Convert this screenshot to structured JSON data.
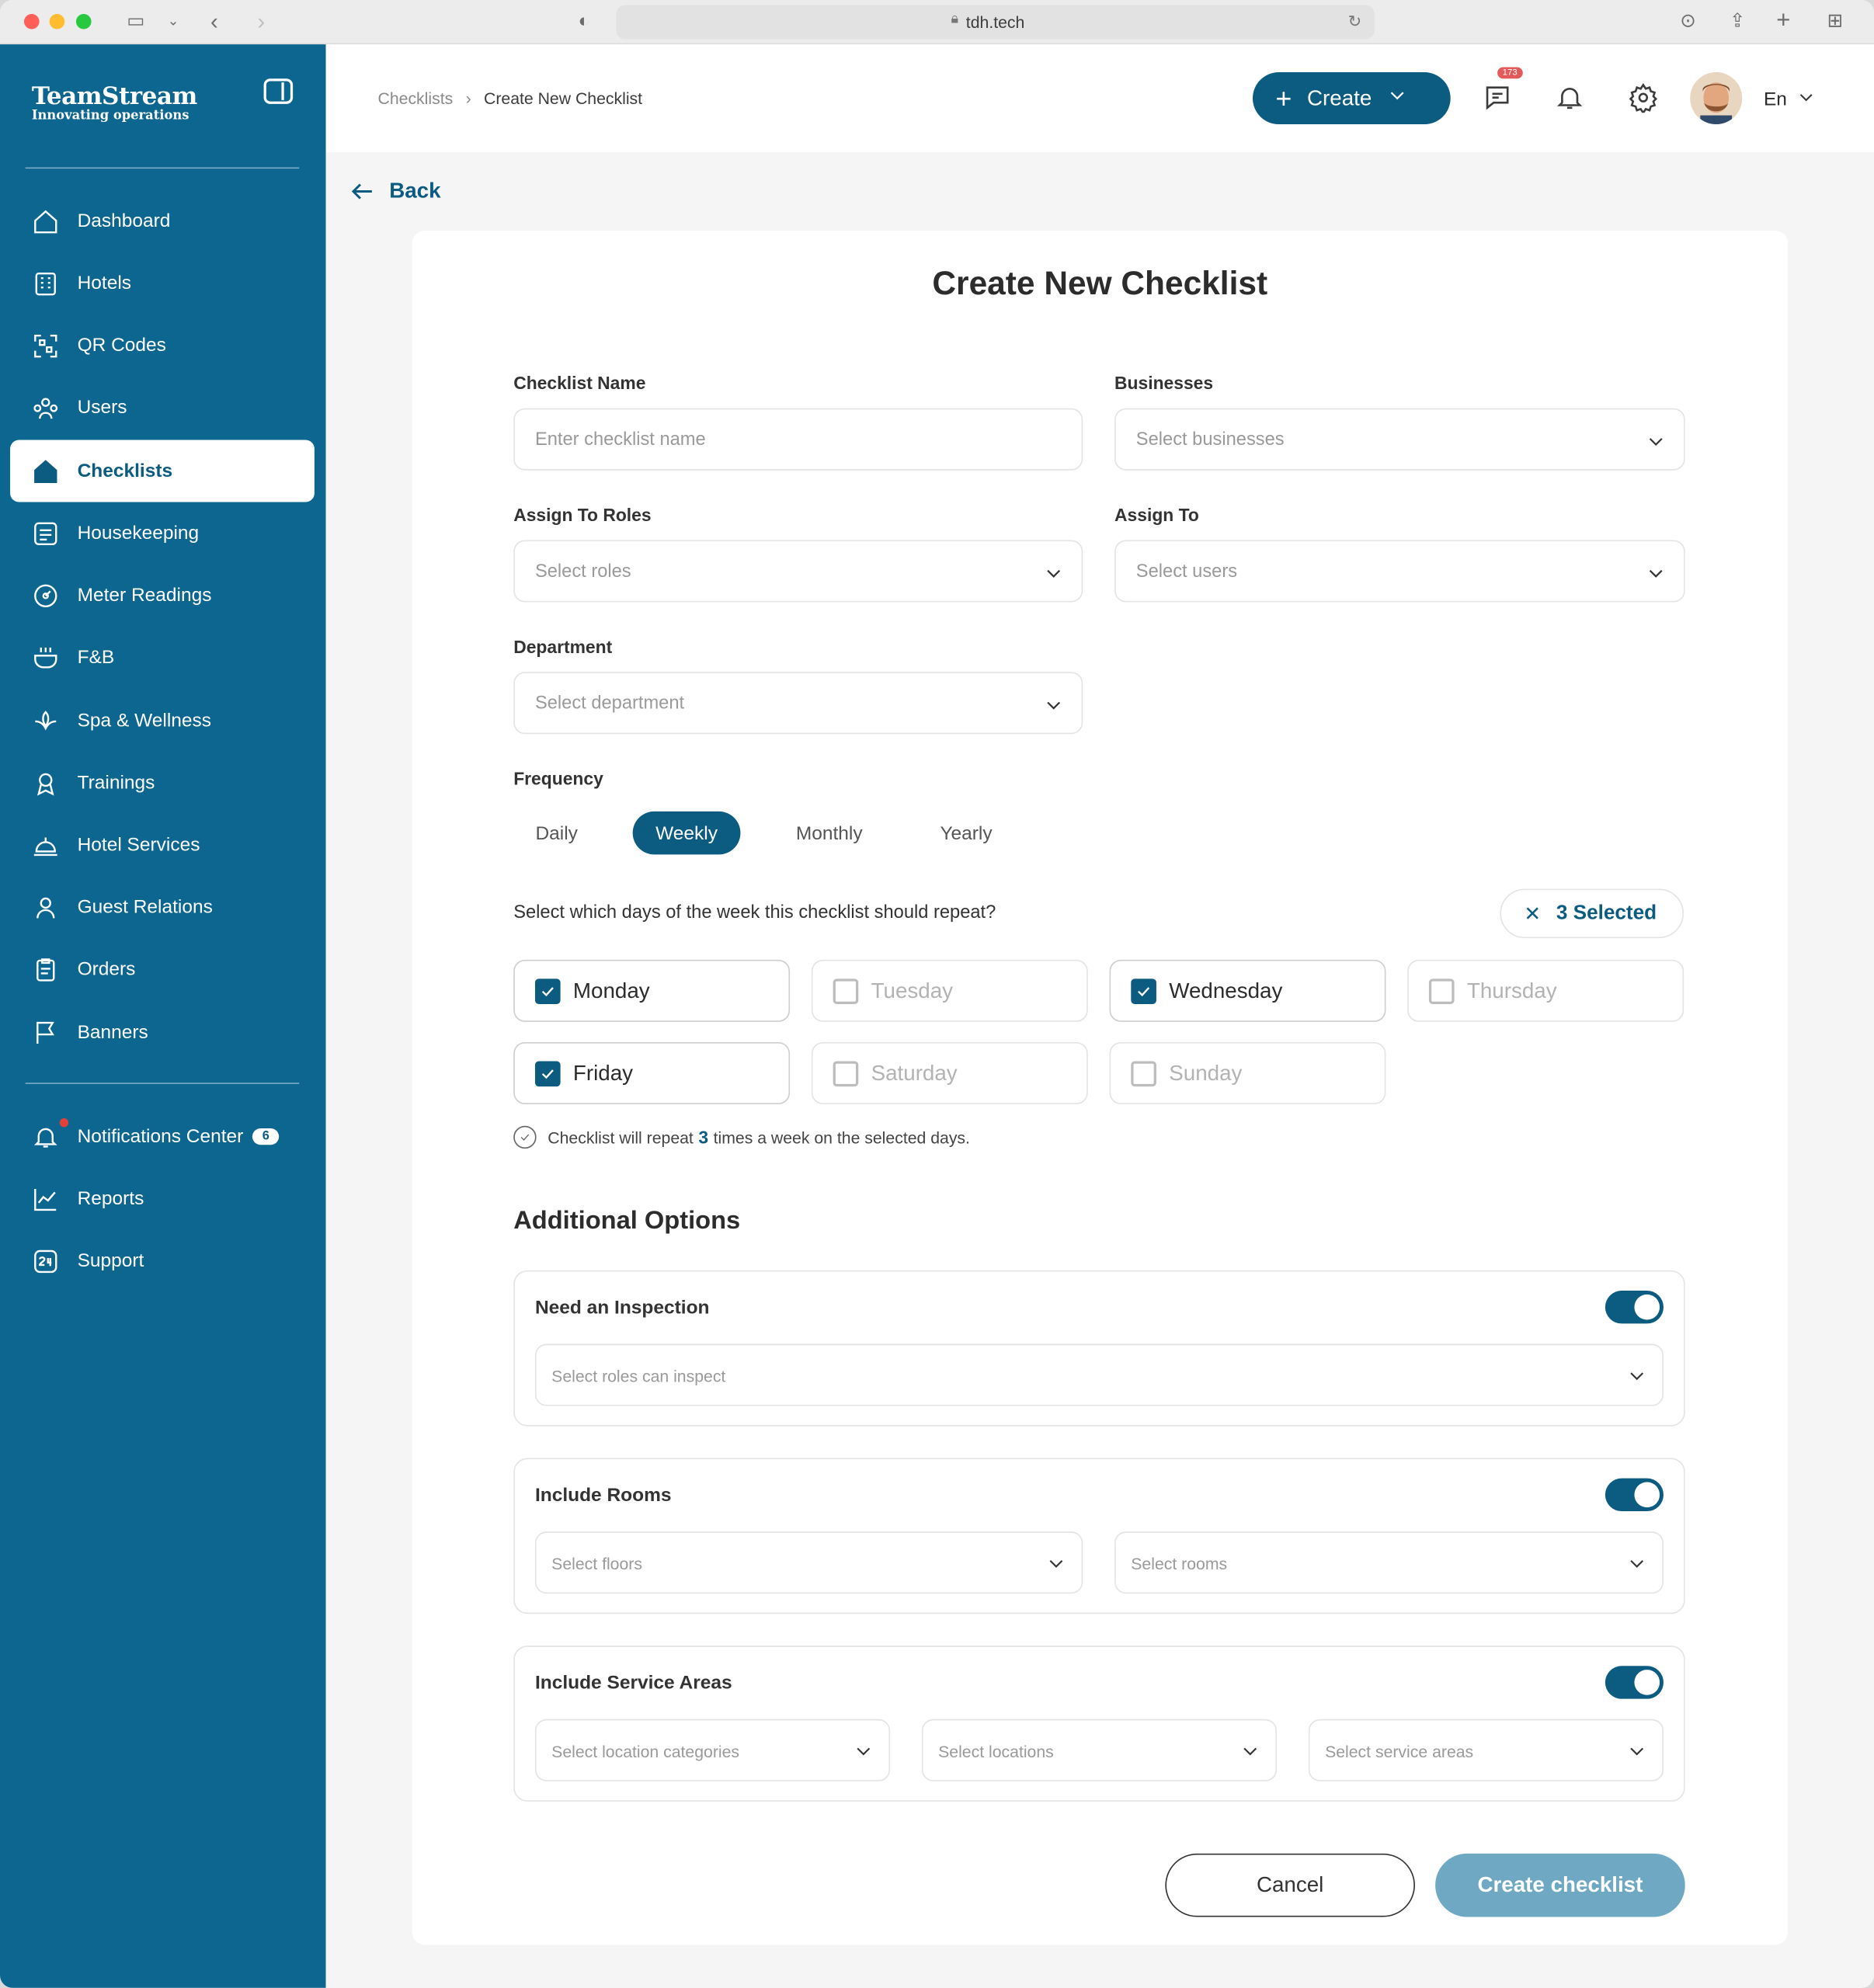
{
  "browser": {
    "url": "tdh.tech"
  },
  "sidebar": {
    "logo_title": "TeamStream",
    "logo_subtitle": "Innovating operations",
    "items": [
      {
        "label": "Dashboard",
        "icon": "home-icon"
      },
      {
        "label": "Hotels",
        "icon": "hotel-icon"
      },
      {
        "label": "QR Codes",
        "icon": "qr-code-icon"
      },
      {
        "label": "Users",
        "icon": "users-icon"
      },
      {
        "label": "Checklists",
        "icon": "checklist-icon",
        "active": true
      },
      {
        "label": "Housekeeping",
        "icon": "housekeeping-icon"
      },
      {
        "label": "Meter Readings",
        "icon": "meter-icon"
      },
      {
        "label": "F&B",
        "icon": "food-icon"
      },
      {
        "label": "Spa & Wellness",
        "icon": "spa-icon"
      },
      {
        "label": "Trainings",
        "icon": "training-icon"
      },
      {
        "label": "Hotel Services",
        "icon": "bell-service-icon"
      },
      {
        "label": "Guest Relations",
        "icon": "guest-icon"
      },
      {
        "label": "Orders",
        "icon": "orders-icon"
      },
      {
        "label": "Banners",
        "icon": "flag-icon"
      }
    ],
    "bottom_items": [
      {
        "label": "Notifications Center",
        "icon": "bell-icon",
        "badge": "6"
      },
      {
        "label": "Reports",
        "icon": "chart-icon"
      },
      {
        "label": "Support",
        "icon": "support-24-icon"
      }
    ]
  },
  "header": {
    "breadcrumb": [
      "Checklists",
      "Create New Checklist"
    ],
    "create_label": "Create",
    "messages_badge": "173",
    "language": "En"
  },
  "main": {
    "back_label": "Back",
    "title": "Create New Checklist",
    "fields": {
      "checklist_name": {
        "label": "Checklist Name",
        "placeholder": "Enter checklist name"
      },
      "businesses": {
        "label": "Businesses",
        "placeholder": "Select businesses"
      },
      "roles": {
        "label": "Assign To Roles",
        "placeholder": "Select roles"
      },
      "assign_to": {
        "label": "Assign To",
        "placeholder": "Select users"
      },
      "department": {
        "label": "Department",
        "placeholder": "Select department"
      }
    },
    "frequency": {
      "label": "Frequency",
      "options": [
        "Daily",
        "Weekly",
        "Monthly",
        "Yearly"
      ],
      "selected": "Weekly"
    },
    "days_question": "Select which days of the week this checklist should repeat?",
    "selected_chip": "3 Selected",
    "days": [
      {
        "label": "Monday",
        "checked": true
      },
      {
        "label": "Tuesday",
        "checked": false
      },
      {
        "label": "Wednesday",
        "checked": true
      },
      {
        "label": "Thursday",
        "checked": false
      },
      {
        "label": "Friday",
        "checked": true
      },
      {
        "label": "Saturday",
        "checked": false
      },
      {
        "label": "Sunday",
        "checked": false
      }
    ],
    "repeat_note": {
      "prefix": "Checklist will repeat",
      "count": "3",
      "suffix": "times a week on the selected days."
    },
    "additional_options": {
      "title": "Additional Options",
      "inspection": {
        "label": "Need an Inspection",
        "enabled": true,
        "placeholder": "Select roles can inspect"
      },
      "rooms": {
        "label": "Include Rooms",
        "enabled": true,
        "floors_placeholder": "Select floors",
        "rooms_placeholder": "Select rooms"
      },
      "service_areas": {
        "label": "Include Service Areas",
        "enabled": true,
        "categories_placeholder": "Select location categories",
        "locations_placeholder": "Select locations",
        "areas_placeholder": "Select service areas"
      }
    },
    "cancel_label": "Cancel",
    "submit_label": "Create checklist"
  },
  "colors": {
    "sidebar": "#0d6690",
    "accent": "#0c5b80",
    "accent_light": "#6ea8c2"
  }
}
